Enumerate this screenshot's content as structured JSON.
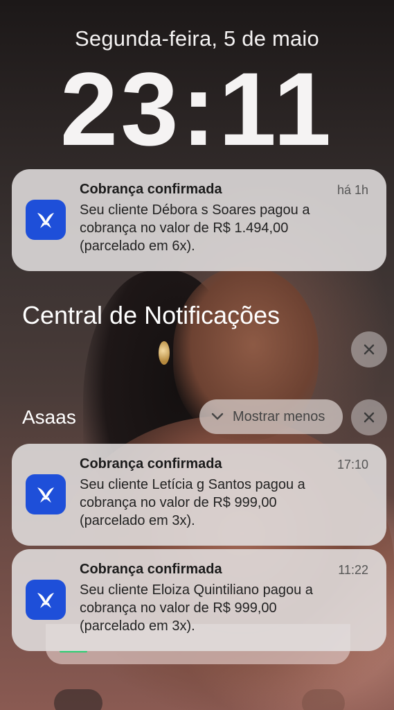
{
  "lockscreen": {
    "date": "Segunda-feira, 5 de maio",
    "time": "23:11"
  },
  "notifications": [
    {
      "app_icon": "asaas-butterfly-icon",
      "title": "Cobrança confirmada",
      "time": "há 1h",
      "body_line1": "Seu cliente Débora s Soares pagou a",
      "body_line2": "cobrança no valor de R$ 1.494,00",
      "body_line3": "(parcelado em 6x)."
    },
    {
      "app_icon": "asaas-butterfly-icon",
      "title": "Cobrança confirmada",
      "time": "17:10",
      "body_line1": "Seu cliente Letícia g Santos pagou a",
      "body_line2": "cobrança no valor de R$ 999,00",
      "body_line3": "(parcelado em 3x)."
    },
    {
      "app_icon": "asaas-butterfly-icon",
      "title": "Cobrança confirmada",
      "time": "11:22",
      "body_line1": "Seu cliente Eloiza Quintiliano pagou a",
      "body_line2": "cobrança no valor de R$ 999,00",
      "body_line3": "(parcelado em 3x)."
    }
  ],
  "notification_center": {
    "title": "Central de Notificações",
    "clear_icon": "close-icon"
  },
  "group": {
    "label": "Asaas",
    "show_less_label": "Mostrar menos",
    "chevron_icon": "chevron-down-icon",
    "close_icon": "close-icon"
  },
  "colors": {
    "app_icon_bg": "#1e4fd9",
    "card_bg": "#e1dede"
  }
}
